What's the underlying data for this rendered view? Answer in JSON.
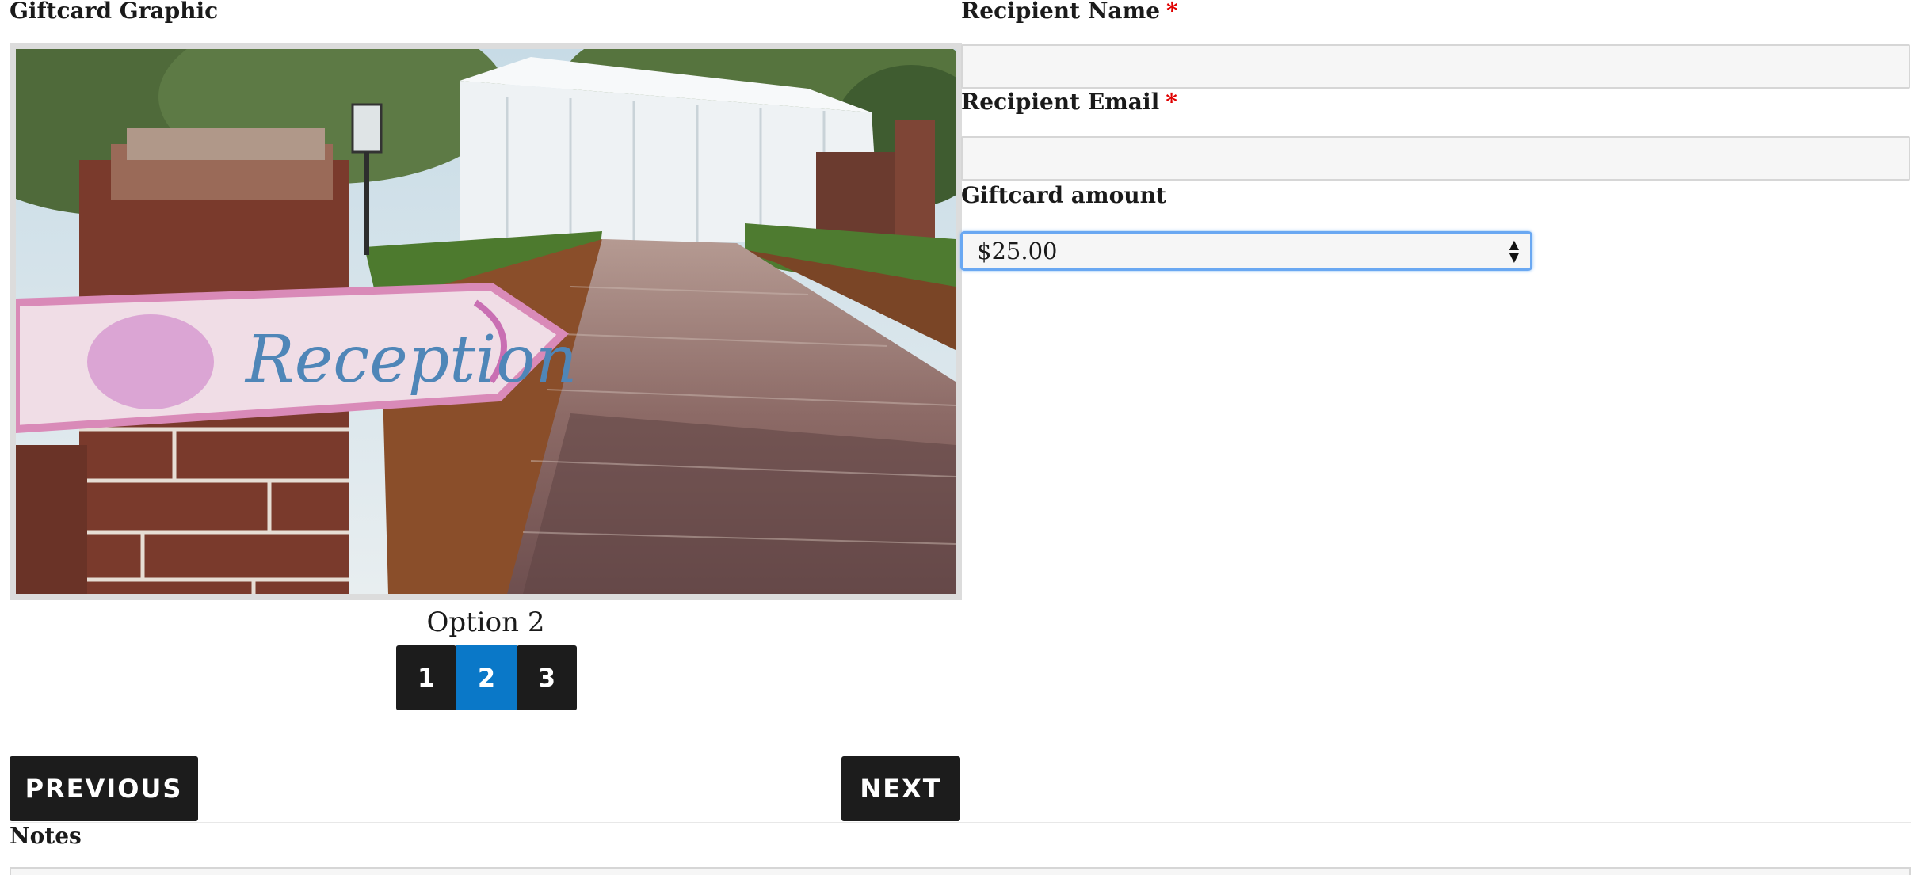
{
  "left": {
    "graphic_label": "Giftcard Graphic",
    "image_sign_text": "Reception",
    "option_caption": "Option 2",
    "pager": [
      {
        "label": "1",
        "active": false
      },
      {
        "label": "2",
        "active": true
      },
      {
        "label": "3",
        "active": false
      }
    ],
    "previous_label": "PREVIOUS",
    "next_label": "NEXT"
  },
  "right": {
    "recipient_name_label": "Recipient Name",
    "recipient_email_label": "Recipient Email",
    "required_mark": "*",
    "recipient_name_value": "",
    "recipient_email_value": "",
    "amount_label": "Giftcard amount",
    "amount_selected": "$25.00"
  },
  "notes": {
    "label": "Notes"
  },
  "colors": {
    "accent_blue": "#0a78c8",
    "button_dark": "#1c1c1c",
    "required_red": "#e00000",
    "focus_ring": "#6aa8f2"
  }
}
